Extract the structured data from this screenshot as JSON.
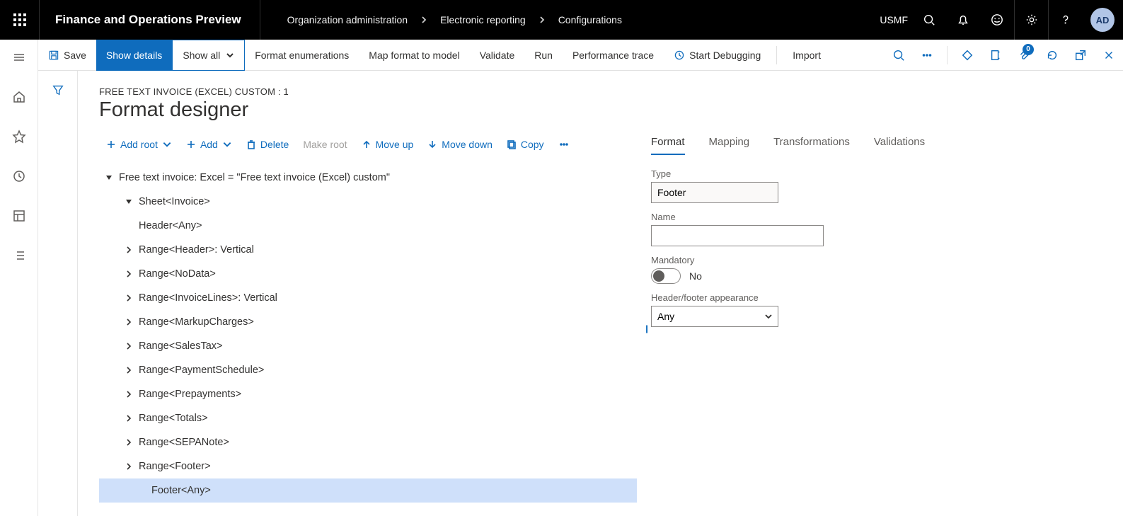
{
  "topbar": {
    "brand": "Finance and Operations Preview",
    "breadcrumbs": [
      "Organization administration",
      "Electronic reporting",
      "Configurations"
    ],
    "company": "USMF",
    "avatar": "AD"
  },
  "actionbar": {
    "save": "Save",
    "show_details": "Show details",
    "show_all": "Show all",
    "format_enumerations": "Format enumerations",
    "map_format": "Map format to model",
    "validate": "Validate",
    "run": "Run",
    "perf_trace": "Performance trace",
    "start_debug": "Start Debugging",
    "import": "Import",
    "attachments_count": "0"
  },
  "page": {
    "pretitle": "FREE TEXT INVOICE (EXCEL) CUSTOM : 1",
    "title": "Format designer"
  },
  "tree_toolbar": {
    "add_root": "Add root",
    "add": "Add",
    "delete": "Delete",
    "make_root": "Make root",
    "move_up": "Move up",
    "move_down": "Move down",
    "copy": "Copy"
  },
  "tree": {
    "root": "Free text invoice: Excel = \"Free text invoice (Excel) custom\"",
    "sheet": "Sheet<Invoice>",
    "header": "Header<Any>",
    "range_header": "Range<Header>: Vertical",
    "range_nodata": "Range<NoData>",
    "range_invoicelines": "Range<InvoiceLines>: Vertical",
    "range_markup": "Range<MarkupCharges>",
    "range_salestax": "Range<SalesTax>",
    "range_paysched": "Range<PaymentSchedule>",
    "range_prepay": "Range<Prepayments>",
    "range_totals": "Range<Totals>",
    "range_sepa": "Range<SEPANote>",
    "range_footer": "Range<Footer>",
    "footer": "Footer<Any>"
  },
  "tabs": {
    "format": "Format",
    "mapping": "Mapping",
    "transformations": "Transformations",
    "validations": "Validations"
  },
  "props": {
    "type_label": "Type",
    "type_value": "Footer",
    "name_label": "Name",
    "name_value": "",
    "mandatory_label": "Mandatory",
    "mandatory_value": "No",
    "appearance_label": "Header/footer appearance",
    "appearance_value": "Any"
  }
}
